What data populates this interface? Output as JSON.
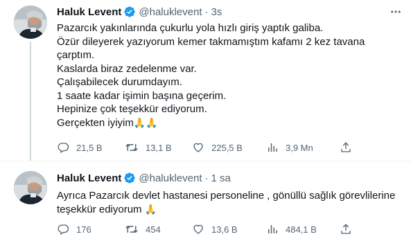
{
  "colors": {
    "text": "#0f1419",
    "secondary": "#536471",
    "verified": "#1d9bf0",
    "thread_line": "#cfd9de",
    "divider": "#eff3f4"
  },
  "tweets": [
    {
      "name": "Haluk Levent",
      "handle": "@haluklevent",
      "separator": "·",
      "time": "3s",
      "avatar_icon": "profile-photo",
      "lines": [
        "Pazarcık yakınlarında çukurlu yola hızlı giriş yaptık galiba.",
        "Özür dileyerek yazıyorum kemer takmamıştım kafamı 2 kez tavana",
        "çarptım.",
        "Kaslarda biraz zedelenme var.",
        "Çalışabilecek durumdayım.",
        "1 saate kadar işimin başına geçerim.",
        "Hepinize çok teşekkür ediyorum.",
        "Gerçekten iyiyim"
      ],
      "emoji": "🙏🙏",
      "stats": {
        "replies": "21,5 B",
        "retweets": "13,1 B",
        "likes": "225,5 B",
        "views": "3,9 Mn"
      }
    },
    {
      "name": "Haluk Levent",
      "handle": "@haluklevent",
      "separator": "·",
      "time": "1 sa",
      "avatar_icon": "profile-photo",
      "lines": [
        "Ayrıca Pazarcık devlet hastanesi personeline , gönüllü sağlık görevlilerine",
        "teşekkür ediyorum"
      ],
      "emoji": "🙏",
      "stats": {
        "replies": "176",
        "retweets": "454",
        "likes": "13,6 B",
        "views": "484,1 B"
      }
    }
  ]
}
